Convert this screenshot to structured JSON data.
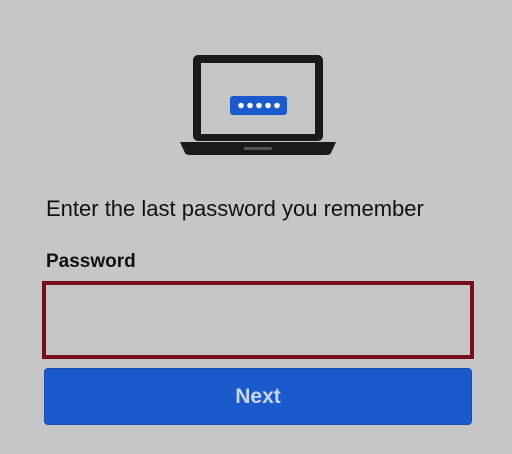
{
  "illustration": {
    "icon": "laptop-password-icon",
    "screen_color": "#1a1a1a",
    "badge_color": "#1a5acc"
  },
  "prompt": {
    "text": "Enter the last password you remember"
  },
  "password_field": {
    "label": "Password",
    "value": "",
    "border_color": "#7a0c19"
  },
  "next_button": {
    "label": "Next",
    "color": "#1a5acc"
  }
}
